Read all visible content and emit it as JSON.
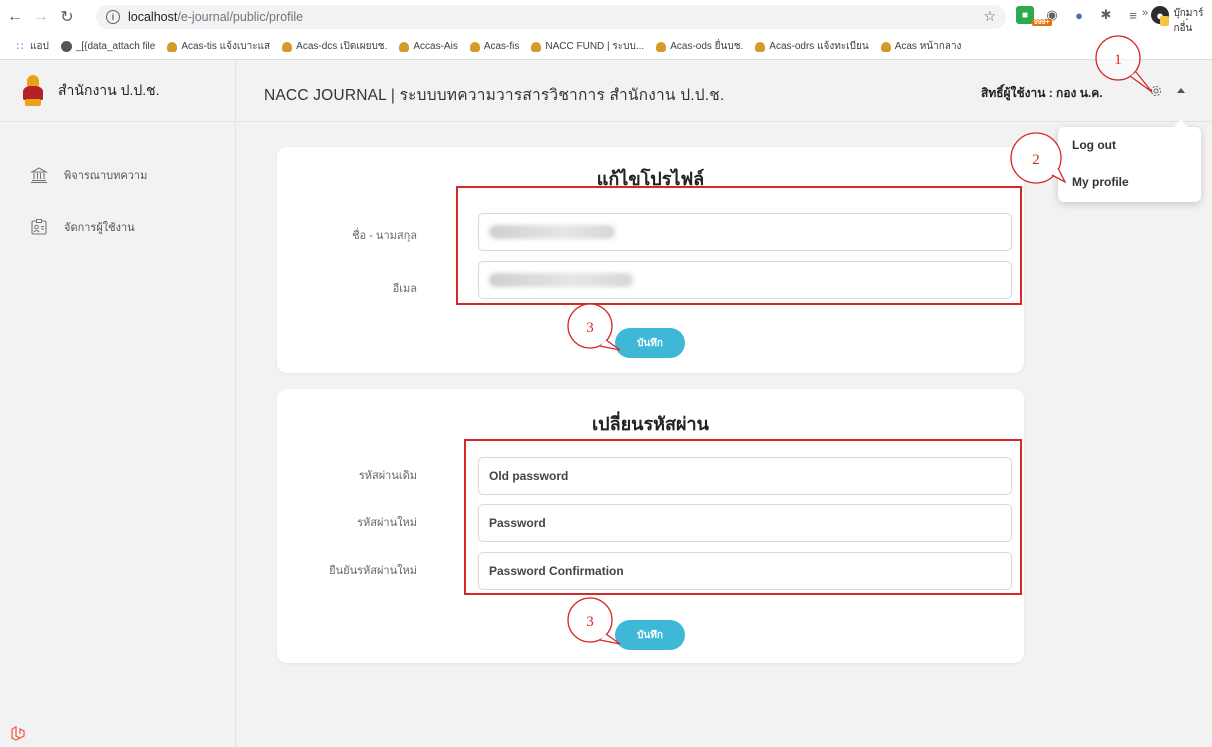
{
  "browser": {
    "url_host": "localhost",
    "url_path": "/e-journal/public/profile",
    "ext_badge": "999+",
    "bookmarks": [
      {
        "label": "แอป",
        "icon": "apps-icon"
      },
      {
        "label": "_[{data_attach file",
        "icon": "chrome-icon"
      },
      {
        "label": "Acas-tis แจ้งเบาะแส",
        "icon": "favicon"
      },
      {
        "label": "Acas-dcs เปิดเผยบช.",
        "icon": "favicon"
      },
      {
        "label": "Accas-Ais",
        "icon": "favicon"
      },
      {
        "label": "Acas-fis",
        "icon": "favicon"
      },
      {
        "label": "NACC FUND | ระบบ...",
        "icon": "favicon"
      },
      {
        "label": "Acas-ods ยื่นบช.",
        "icon": "favicon"
      },
      {
        "label": "Acas-odrs แจ้งทะเบียน",
        "icon": "favicon"
      },
      {
        "label": "Acas หน้ากลาง",
        "icon": "favicon"
      }
    ],
    "bookmarks_more": "»",
    "other_bookmarks": "บุ๊กมาร์กอื่น"
  },
  "sidebar": {
    "brand": "สำนักงาน ป.ป.ช.",
    "items": [
      {
        "label": "พิจารณาบทความ",
        "icon": "institution-icon"
      },
      {
        "label": "จัดการผู้ใช้งาน",
        "icon": "user-card-icon"
      }
    ]
  },
  "header": {
    "title": "NACC JOURNAL | ระบบบทความวารสารวิชาการ สำนักงาน ป.ป.ช.",
    "user_label": "สิทธิ์ผู้ใช้งาน : กอง น.ค."
  },
  "dropdown": {
    "items": [
      "Log out",
      "My profile"
    ]
  },
  "profile_card": {
    "title": "แก้ไขโปรไฟล์",
    "fields": [
      {
        "label": "ชื่อ - นามสกุล",
        "value": ""
      },
      {
        "label": "อีเมล",
        "value": ""
      }
    ],
    "save_label": "บันทึก"
  },
  "password_card": {
    "title": "เปลี่ยนรหัสผ่าน",
    "fields": [
      {
        "label": "รหัสผ่านเดิม",
        "placeholder": "Old password"
      },
      {
        "label": "รหัสผ่านใหม่",
        "placeholder": "Password"
      },
      {
        "label": "ยืนยันรหัสผ่านใหม่",
        "placeholder": "Password Confirmation"
      }
    ],
    "save_label": "บันทึก"
  },
  "annotations": {
    "step1": "1",
    "step2": "2",
    "step3a": "3",
    "step3b": "3",
    "color": "#d62828"
  }
}
